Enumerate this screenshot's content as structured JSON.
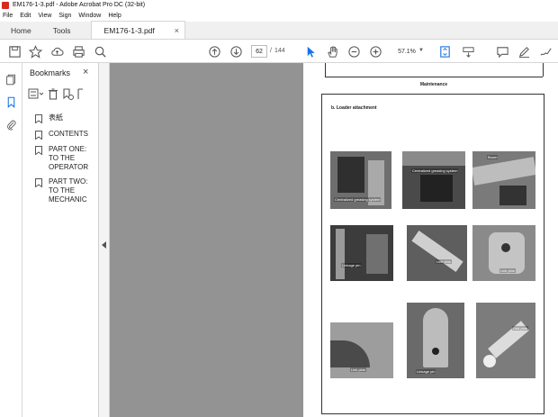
{
  "window": {
    "title": "EM176-1-3.pdf - Adobe Acrobat Pro DC (32-bit)"
  },
  "menu": {
    "items": [
      "File",
      "Edit",
      "View",
      "Sign",
      "Window",
      "Help"
    ]
  },
  "tabs": {
    "home": "Home",
    "tools": "Tools",
    "document": "EM176-1-3.pdf",
    "close": "×"
  },
  "toolbar": {
    "page_current": "62",
    "page_sep": "/",
    "page_total": "144",
    "zoom": "57.1%"
  },
  "bookmarks": {
    "title": "Bookmarks",
    "close": "×",
    "items": [
      {
        "label": "表紙"
      },
      {
        "label": "CONTENTS"
      },
      {
        "label": "PART ONE: TO THE OPERATOR"
      },
      {
        "label": "PART TWO: TO THE MECHANIC"
      }
    ]
  },
  "document_page": {
    "header": "Maintenance",
    "section": "b.   Loader attachment",
    "photo_labels": [
      "Centralized greasing system",
      "Centralized greasing system",
      "Boom",
      "Linkage pin",
      "Link pins",
      "Link pins",
      "Link pins",
      "Linkage pin",
      "Link pins"
    ]
  },
  "colors": {
    "acrobat_red": "#d62b1f",
    "canvas_gray": "#939393",
    "select_blue": "#1473e6"
  }
}
